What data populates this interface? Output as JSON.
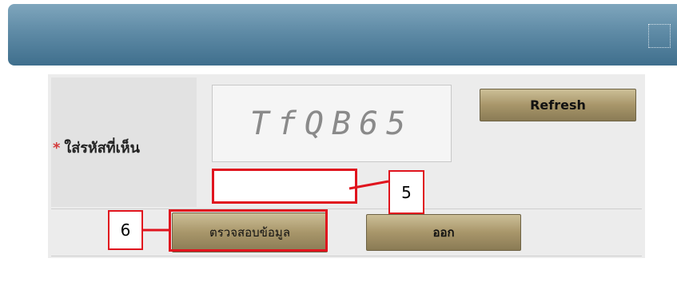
{
  "captcha": {
    "required_marker": "*",
    "label": "ใส่รหัสที่เห็น",
    "image_text": "TfQB65",
    "refresh_label": "Refresh",
    "input_value": ""
  },
  "actions": {
    "verify_label": "ตรวจสอบข้อมูล",
    "exit_label": "ออก"
  },
  "annotations": {
    "input_callout": "5",
    "verify_callout": "6"
  },
  "colors": {
    "header": "#5f8ba6",
    "highlight": "#e0141e",
    "button": "#a8966a"
  }
}
